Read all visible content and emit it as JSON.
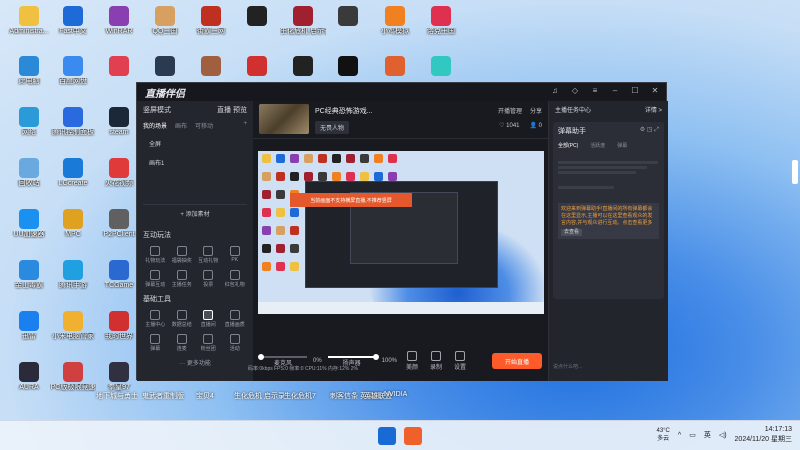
{
  "desktop_icons": [
    {
      "label": "Administra...",
      "color": "#f0c040"
    },
    {
      "label": "Fast中文",
      "color": "#1e6ad6"
    },
    {
      "label": "WinRAR",
      "color": "#8a3fb0"
    },
    {
      "label": "QQ三国",
      "color": "#d8a060"
    },
    {
      "label": "街霸三网",
      "color": "#c03020"
    },
    {
      "label": "",
      "color": "#222222"
    },
    {
      "label": "生化危机 启示录",
      "color": "#a02030"
    },
    {
      "label": "",
      "color": "#3a3a3a"
    },
    {
      "label": "小鸡模拟",
      "color": "#f08020"
    },
    {
      "label": "洛克王国",
      "color": "#e03050"
    },
    {
      "label": "此电脑",
      "color": "#2a8ad8"
    },
    {
      "label": "百度网盘",
      "color": "#3a8af0"
    },
    {
      "label": "",
      "color": "#e04050"
    },
    {
      "label": "",
      "color": "#2a3a50"
    },
    {
      "label": "",
      "color": "#a06040"
    },
    {
      "label": "",
      "color": "#d03030"
    },
    {
      "label": "",
      "color": "#222222"
    },
    {
      "label": "",
      "color": "#111111"
    },
    {
      "label": "",
      "color": "#e06030"
    },
    {
      "label": "",
      "color": "#30c8c0"
    },
    {
      "label": "网络",
      "color": "#2a9ad8"
    },
    {
      "label": "腾讯控制面板",
      "color": "#2a6ae0"
    },
    {
      "label": "steam",
      "color": "#1b2838"
    },
    {
      "label": "回收站",
      "color": "#6aa8e0"
    },
    {
      "label": "LGcreate",
      "color": "#1a7ad8"
    },
    {
      "label": "火花视频",
      "color": "#e03a3a"
    },
    {
      "label": "UU加速器",
      "color": "#1a90f0"
    },
    {
      "label": "MPC",
      "color": "#e0a020"
    },
    {
      "label": "P2PClient",
      "color": "#606060"
    },
    {
      "label": "金山毒霸",
      "color": "#2a8ae0"
    },
    {
      "label": "腾讯手游",
      "color": "#20a0e0"
    },
    {
      "label": "TCGame",
      "color": "#2a6ad0"
    },
    {
      "label": "迅雷",
      "color": "#1a80f0"
    },
    {
      "label": "小米电脑管家",
      "color": "#f0b030"
    },
    {
      "label": "我的世界",
      "color": "#d03030"
    },
    {
      "label": "AURA",
      "color": "#2a2a3a"
    },
    {
      "label": "PC版极限竞速",
      "color": "#d04040"
    },
    {
      "label": "拳皇97",
      "color": "#303040"
    }
  ],
  "taskbar_strip_labels": [
    "地下城与勇士",
    "鬼武者重制版",
    "宝贝4",
    "生化危机 启示录",
    "生化危机7",
    "刺客信条 英灵殿",
    "英雄联盟",
    "NVIDIA"
  ],
  "app": {
    "title": "直播伴侣",
    "window_controls": [
      "headset-icon",
      "shirt-icon",
      "menu-icon",
      "minimize-icon",
      "maximize-icon",
      "close-icon"
    ],
    "sidebar": {
      "mode_label": "竖屏模式",
      "mode_right": [
        "直播",
        "预览"
      ],
      "tabs": [
        "我的场景",
        "画布",
        "可移动"
      ],
      "add": "+",
      "scenes": [
        "全屏",
        "画布1"
      ],
      "add_source": "+ 添加素材",
      "interactive_title": "互动玩法",
      "interactive_tools": [
        "礼物玩法",
        "福袋抽奖",
        "互动礼物",
        "PK",
        "弹幕互动",
        "主播任务",
        "投票",
        "红包礼物"
      ],
      "basic_title": "基础工具",
      "basic_tools": [
        "主播中心",
        "数据总结",
        "直播间",
        "直播画质",
        "弹幕",
        "连麦",
        "粉丝团",
        "活动"
      ],
      "more": "··· 更多功能"
    },
    "stream": {
      "title": "PC经典恐怖游戏...",
      "tag_button": "无畏人物",
      "header_actions": [
        "开播管理",
        "分享"
      ],
      "likes": "1041",
      "viewers": "0"
    },
    "preview": {
      "banner": "当前画面不支持横屏直播,不推荐竖屏",
      "hidden": true
    },
    "controls": {
      "mic_label": "麦克风",
      "mic_percent": "0%",
      "mic_level": 0.04,
      "speaker_label": "扬声器",
      "speaker_percent": "100%",
      "speaker_level": 1.0,
      "buttons": [
        "美颜",
        "录制",
        "设置"
      ],
      "go_live": "开始直播"
    },
    "status_line": "码率:0kbps   FPS:0   帧率:0   CPU:11%   内存:12%   2%",
    "right_panel": {
      "header": "主播任务中心",
      "header_link": "详情 >",
      "card_title": "弹幕助手",
      "card_icons": [
        "settings-icon",
        "pin-icon",
        "popout-icon"
      ],
      "card_tabs": [
        "全部(PC)",
        "活跃度",
        "弹幕"
      ],
      "notice": "欢迎来到弹幕助手!直播间的所有弹幕都会在这里显示,主播可以在这里查看观众的发言内容,并与观众进行互动。点击查看更多",
      "notice_more": "去查看",
      "input_placeholder": "说点什么吧..."
    }
  },
  "taskbar": {
    "weather_temp": "43°C",
    "weather_desc": "多云",
    "tray": [
      "chevron-up-icon",
      "network-icon",
      "speaker-icon"
    ],
    "ime": "英",
    "time": "14:17:13",
    "date": "2024/11/20 星期三"
  }
}
